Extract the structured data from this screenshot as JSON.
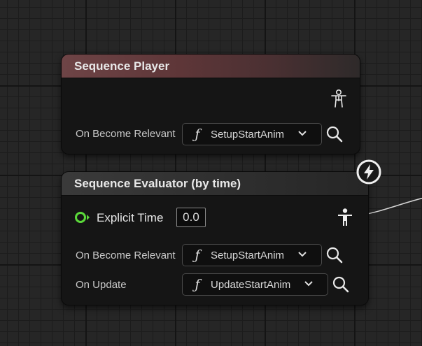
{
  "nodes": [
    {
      "title": "Sequence Player",
      "rows": [
        {
          "label": "On Become Relevant",
          "function": "SetupStartAnim"
        }
      ]
    },
    {
      "title": "Sequence Evaluator (by time)",
      "explicit_time": {
        "label": "Explicit Time",
        "value": "0.0"
      },
      "rows": [
        {
          "label": "On Become Relevant",
          "function": "SetupStartAnim"
        },
        {
          "label": "On Update",
          "function": "UpdateStartAnim"
        }
      ]
    }
  ],
  "icons": {
    "function": "ƒ",
    "dropdown": "chevron-down-icon",
    "search": "search-icon",
    "pose": "pose-icon",
    "lightning": "lightning-icon",
    "pin": "float-pin-icon"
  },
  "colors": {
    "player_title": "#6e4446",
    "evaluator_title": "#3a3a3a",
    "float_pin": "#5bd93a",
    "wire": "#e0e0e0"
  }
}
